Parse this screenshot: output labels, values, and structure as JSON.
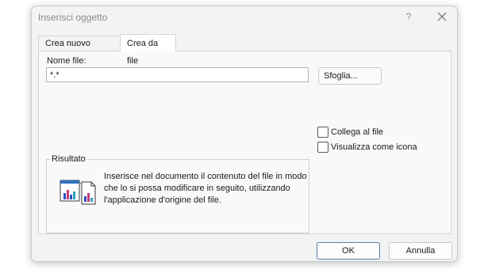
{
  "window": {
    "title": "Inserisci oggetto",
    "help_label": "?"
  },
  "tabs": [
    {
      "label": "Crea nuovo oggetto",
      "active": false
    },
    {
      "label": "Crea da file",
      "active": true
    }
  ],
  "file": {
    "label": "Nome file:",
    "value": "*.*",
    "browse_label": "Sfoglia..."
  },
  "options": {
    "link_label": "Collega al file",
    "link_checked": false,
    "icon_label": "Visualizza come icona",
    "icon_checked": false
  },
  "result": {
    "title": "Risultato",
    "text": "Inserisce nel documento il contenuto del file in modo che lo si possa modificare in seguito, utilizzando l'applicazione d'origine del file.",
    "icon": "embed-document-icon"
  },
  "footer": {
    "ok_label": "OK",
    "cancel_label": "Annulla"
  },
  "colors": {
    "dialog_bg": "#f3f3f3",
    "panel_bg": "#f9f9f9",
    "accent": "#5b7ea6"
  }
}
